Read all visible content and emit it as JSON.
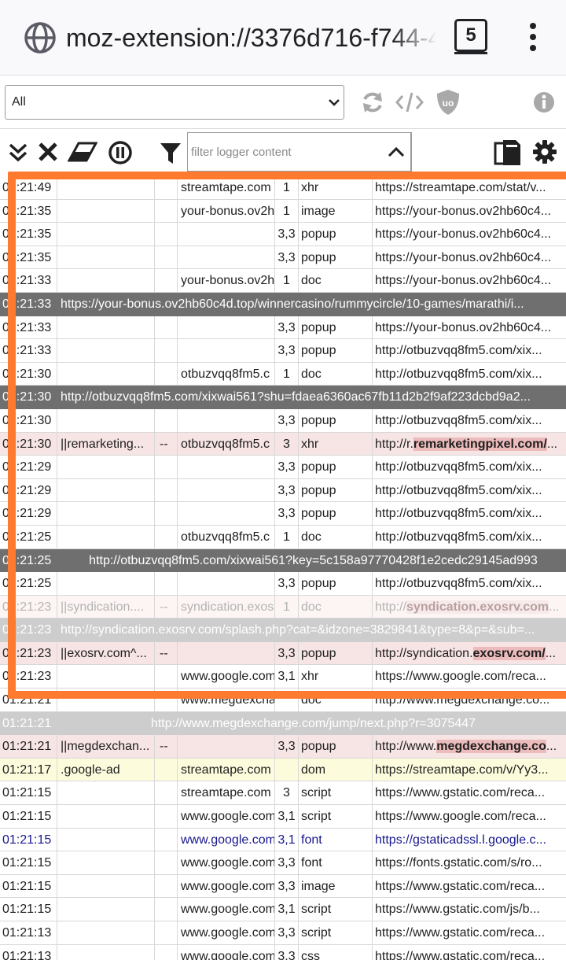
{
  "browser": {
    "url": "moz-extension://3376d716-f744-4",
    "tab_count": "5"
  },
  "toolbar": {
    "tab_filter_selected": "All",
    "filter_placeholder": "filter logger content"
  },
  "colors": {
    "blocked_bg": "#f7e4e4",
    "highlight_bg": "#ecbbbb",
    "cosmetic_bg": "#fcfcdd",
    "doc_bg": "#6f6f6f",
    "doc_light_bg": "#cdcdcd",
    "selection_frame": "#fe7a2e",
    "font_row_text": "#17178f"
  },
  "log": [
    {
      "kind": "row",
      "time": "01:21:49",
      "filter": "",
      "rule": "",
      "context": "streamtape.com",
      "party": "1",
      "type": "xhr",
      "url": "https://streamtape.com/stat/v..."
    },
    {
      "kind": "row",
      "time": "01:21:35",
      "filter": "",
      "rule": "",
      "context": "your-bonus.ov2h",
      "party": "1",
      "type": "image",
      "url": "https://your-bonus.ov2hb60c4..."
    },
    {
      "kind": "row",
      "time": "01:21:35",
      "filter": "",
      "rule": "",
      "context": "",
      "party": "3,3",
      "type": "popup",
      "url": "https://your-bonus.ov2hb60c4..."
    },
    {
      "kind": "row",
      "time": "01:21:35",
      "filter": "",
      "rule": "",
      "context": "",
      "party": "3,3",
      "type": "popup",
      "url": "https://your-bonus.ov2hb60c4..."
    },
    {
      "kind": "row",
      "time": "01:21:33",
      "filter": "",
      "rule": "",
      "context": "your-bonus.ov2h",
      "party": "1",
      "type": "doc",
      "url": "https://your-bonus.ov2hb60c4..."
    },
    {
      "kind": "doc",
      "time": "01:21:33",
      "url": "https://your-bonus.ov2hb60c4d.top/winnercasino/rummycircle/10-games/marathi/i..."
    },
    {
      "kind": "row",
      "time": "01:21:33",
      "filter": "",
      "rule": "",
      "context": "",
      "party": "3,3",
      "type": "popup",
      "url": "https://your-bonus.ov2hb60c4..."
    },
    {
      "kind": "row",
      "time": "01:21:33",
      "filter": "",
      "rule": "",
      "context": "",
      "party": "3,3",
      "type": "popup",
      "url": "http://otbuzvqq8fm5.com/xix..."
    },
    {
      "kind": "row",
      "time": "01:21:30",
      "filter": "",
      "rule": "",
      "context": "otbuzvqq8fm5.c",
      "party": "1",
      "type": "doc",
      "url": "http://otbuzvqq8fm5.com/xix..."
    },
    {
      "kind": "doc",
      "time": "01:21:30",
      "url": "http://otbuzvqq8fm5.com/xixwai561?shu=fdaea6360ac67fb11d2b2f9af223dcbd9a2..."
    },
    {
      "kind": "row",
      "time": "01:21:30",
      "filter": "",
      "rule": "",
      "context": "",
      "party": "3,3",
      "type": "popup",
      "url": "http://otbuzvqq8fm5.com/xix..."
    },
    {
      "kind": "blocked",
      "time": "01:21:30",
      "filter": "||remarketing...",
      "rule": "--",
      "context": "otbuzvqq8fm5.c",
      "party": "3",
      "type": "xhr",
      "url_pre": "http://r.",
      "url_hl": "remarketingpixel.com/",
      "url_post": "..."
    },
    {
      "kind": "row",
      "time": "01:21:29",
      "filter": "",
      "rule": "",
      "context": "",
      "party": "3,3",
      "type": "popup",
      "url": "http://otbuzvqq8fm5.com/xix..."
    },
    {
      "kind": "row",
      "time": "01:21:29",
      "filter": "",
      "rule": "",
      "context": "",
      "party": "3,3",
      "type": "popup",
      "url": "http://otbuzvqq8fm5.com/xix..."
    },
    {
      "kind": "row",
      "time": "01:21:29",
      "filter": "",
      "rule": "",
      "context": "",
      "party": "3,3",
      "type": "popup",
      "url": "http://otbuzvqq8fm5.com/xix..."
    },
    {
      "kind": "row",
      "time": "01:21:25",
      "filter": "",
      "rule": "",
      "context": "otbuzvqq8fm5.c",
      "party": "1",
      "type": "doc",
      "url": "http://otbuzvqq8fm5.com/xix..."
    },
    {
      "kind": "doc-center",
      "time": "01:21:25",
      "url": "http://otbuzvqq8fm5.com/xixwai561?key=5c158a97770428f1e2cedc29145ad993"
    },
    {
      "kind": "row",
      "time": "01:21:25",
      "filter": "",
      "rule": "",
      "context": "",
      "party": "3,3",
      "type": "popup",
      "url": "http://otbuzvqq8fm5.com/xix..."
    },
    {
      "kind": "faded",
      "time": "01:21:23",
      "filter": "||syndication....",
      "rule": "--",
      "context": "syndication.exos",
      "party": "1",
      "type": "doc",
      "url_pre": "http://",
      "url_hl": "syndication.exosrv.com",
      "url_post": "..."
    },
    {
      "kind": "doc-light",
      "time": "01:21:23",
      "url": "http://syndication.exosrv.com/splash.php?cat=&idzone=3829841&type=8&p=&sub=..."
    },
    {
      "kind": "blocked",
      "time": "01:21:23",
      "filter": "||exosrv.com^...",
      "rule": "--",
      "context": "",
      "party": "3,3",
      "type": "popup",
      "url_pre": "http://syndication.",
      "url_hl": "exosrv.com/",
      "url_post": "..."
    },
    {
      "kind": "row",
      "time": "01:21:23",
      "filter": "",
      "rule": "",
      "context": "www.google.com",
      "party": "3,1",
      "type": "xhr",
      "url": "https://www.google.com/reca..."
    },
    {
      "kind": "row",
      "time": "01:21:21",
      "filter": "",
      "rule": "",
      "context": "www.megdexchange",
      "party": "",
      "type": "doc",
      "url": "http://www.megdexchange.co..."
    },
    {
      "kind": "doc-light-center",
      "time": "01:21:21",
      "url": "http://www.megdexchange.com/jump/next.php?r=3075447"
    },
    {
      "kind": "blocked",
      "time": "01:21:21",
      "filter": "||megdexchan...",
      "rule": "--",
      "context": "",
      "party": "3,3",
      "type": "popup",
      "url_pre": "http://www.",
      "url_hl": "megdexchange.co",
      "url_post": "..."
    },
    {
      "kind": "cosmetic",
      "time": "01:21:17",
      "filter": ".google-ad",
      "rule": "",
      "context": "streamtape.com",
      "party": "",
      "type": "dom",
      "url": "https://streamtape.com/v/Yy3..."
    },
    {
      "kind": "row",
      "time": "01:21:15",
      "filter": "",
      "rule": "",
      "context": "streamtape.com",
      "party": "3",
      "type": "script",
      "url": "https://www.gstatic.com/reca..."
    },
    {
      "kind": "row",
      "time": "01:21:15",
      "filter": "",
      "rule": "",
      "context": "www.google.com",
      "party": "3,1",
      "type": "script",
      "url": "https://www.google.com/reca..."
    },
    {
      "kind": "font",
      "time": "01:21:15",
      "filter": "",
      "rule": "",
      "context": "www.google.com",
      "party": "3,1",
      "type": "font",
      "url": "https://gstaticadssl.l.google.c..."
    },
    {
      "kind": "row",
      "time": "01:21:15",
      "filter": "",
      "rule": "",
      "context": "www.google.com",
      "party": "3,3",
      "type": "font",
      "url": "https://fonts.gstatic.com/s/ro..."
    },
    {
      "kind": "row",
      "time": "01:21:15",
      "filter": "",
      "rule": "",
      "context": "www.google.com",
      "party": "3,3",
      "type": "image",
      "url": "https://www.gstatic.com/reca..."
    },
    {
      "kind": "row",
      "time": "01:21:15",
      "filter": "",
      "rule": "",
      "context": "www.google.com",
      "party": "3,1",
      "type": "script",
      "url": "https://www.gstatic.com/js/b..."
    },
    {
      "kind": "row",
      "time": "01:21:13",
      "filter": "",
      "rule": "",
      "context": "www.google.com",
      "party": "3,3",
      "type": "script",
      "url": "https://www.gstatic.com/reca..."
    },
    {
      "kind": "row",
      "time": "01:21:13",
      "filter": "",
      "rule": "",
      "context": "www.google.com",
      "party": "3,3",
      "type": "css",
      "url": "https://www.gstatic.com/reca..."
    }
  ]
}
